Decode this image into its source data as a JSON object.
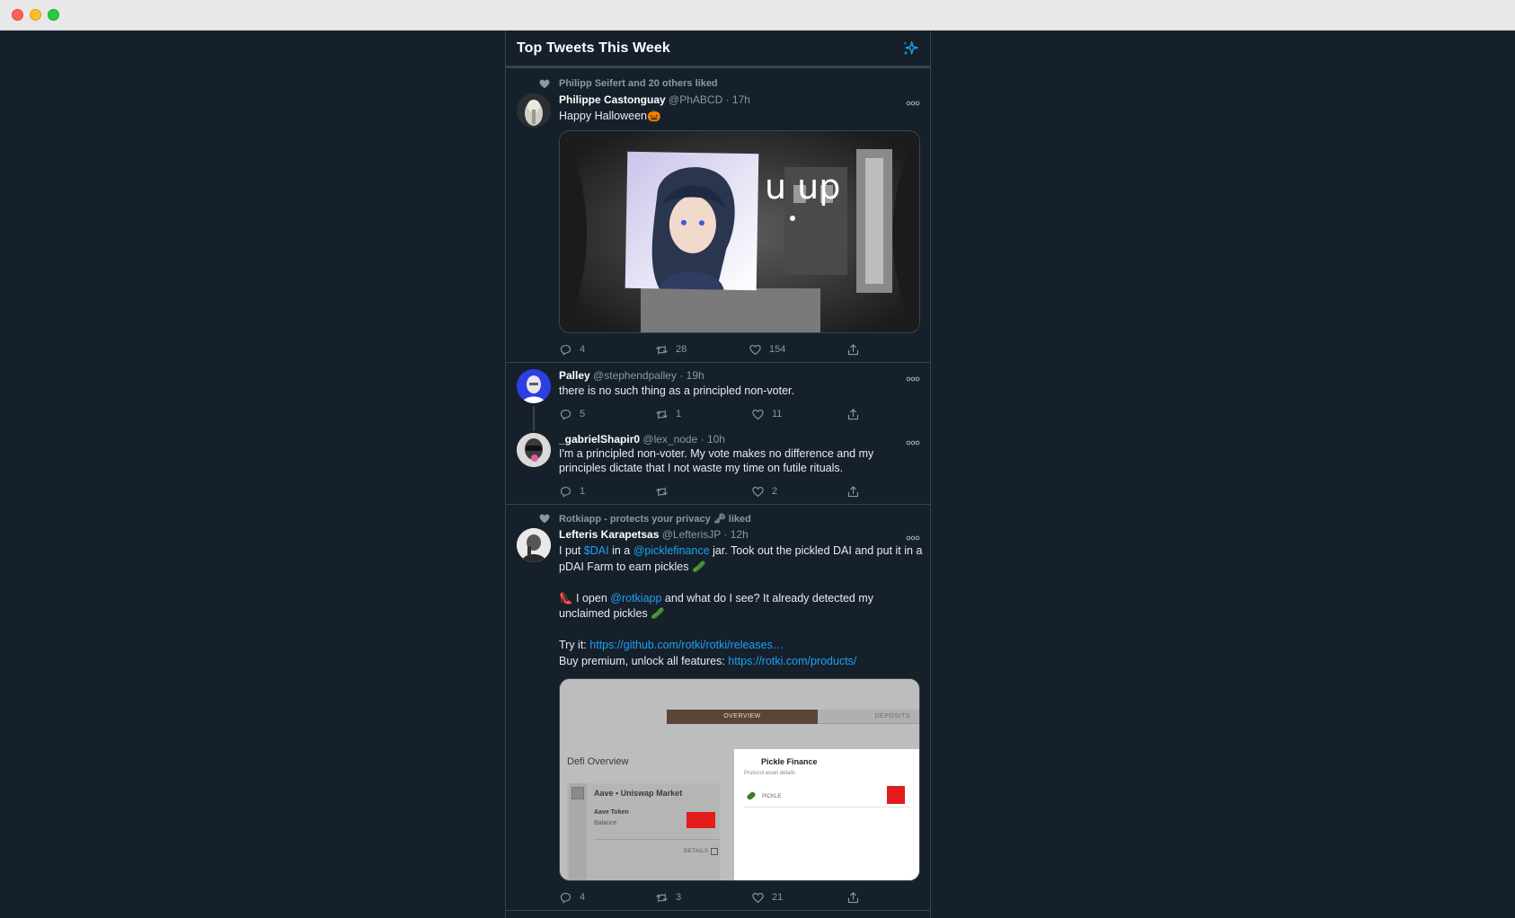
{
  "header": {
    "title": "Top Tweets This Week",
    "sparkle_icon": "sparkle-icon"
  },
  "tweets": [
    {
      "context": "Philipp Seifert and 20 others liked",
      "name": "Philippe Castonguay",
      "handle": "@PhABCD",
      "time": "· 17h",
      "text": "Happy Halloween🎃",
      "media": {
        "caption": "u up"
      },
      "replies": "4",
      "retweets": "28",
      "likes": "154"
    },
    {
      "name": "Palley",
      "handle": "@stephendpalley",
      "time": "· 19h",
      "text": "there is no such thing as a principled non-voter.",
      "replies": "5",
      "retweets": "1",
      "likes": "11"
    },
    {
      "name": "_gabrielShapir0",
      "handle": "@lex_node",
      "time": "· 10h",
      "text": "I'm a principled non-voter. My vote makes no difference and my principles dictate that I not waste my time on futile rituals.",
      "replies": "1",
      "retweets": "",
      "likes": "2"
    },
    {
      "context": "Rotkiapp - protects your privacy 🗝 liked",
      "name": "Lefteris Karapetsas",
      "handle": "@LefterisJP",
      "time": "· 12h",
      "p1_a": "I put ",
      "p1_link1": "$DAI",
      "p1_b": " in a ",
      "p1_link2": "@picklefinance",
      "p1_c": " jar. Took out the pickled DAI and put it in a pDAI Farm to earn pickles 🥒",
      "p2_a": "👠 I open ",
      "p2_link": "@rotkiapp",
      "p2_b": " and what do I see? It already detected my unclaimed pickles 🥒",
      "p3_a": "Try it: ",
      "p3_link": "https://github.com/rotki/rotki/releases…",
      "p4_a": "Buy premium, unlock all features: ",
      "p4_link": "https://rotki.com/products/",
      "media": {
        "tab_overview": "OVERVIEW",
        "tab_deposits": "DEPOSITS",
        "defi_title": "Defi Overview",
        "card_title": "Aave • Uniswap Market",
        "token_label": "Aave Token",
        "balance_label": "Balance",
        "details_label": "DETAILS",
        "dialog_title": "Pickle Finance",
        "dialog_subtitle": "Protocol asset details",
        "asset_label": "PICKLE"
      },
      "replies": "4",
      "retweets": "3",
      "likes": "21"
    }
  ]
}
